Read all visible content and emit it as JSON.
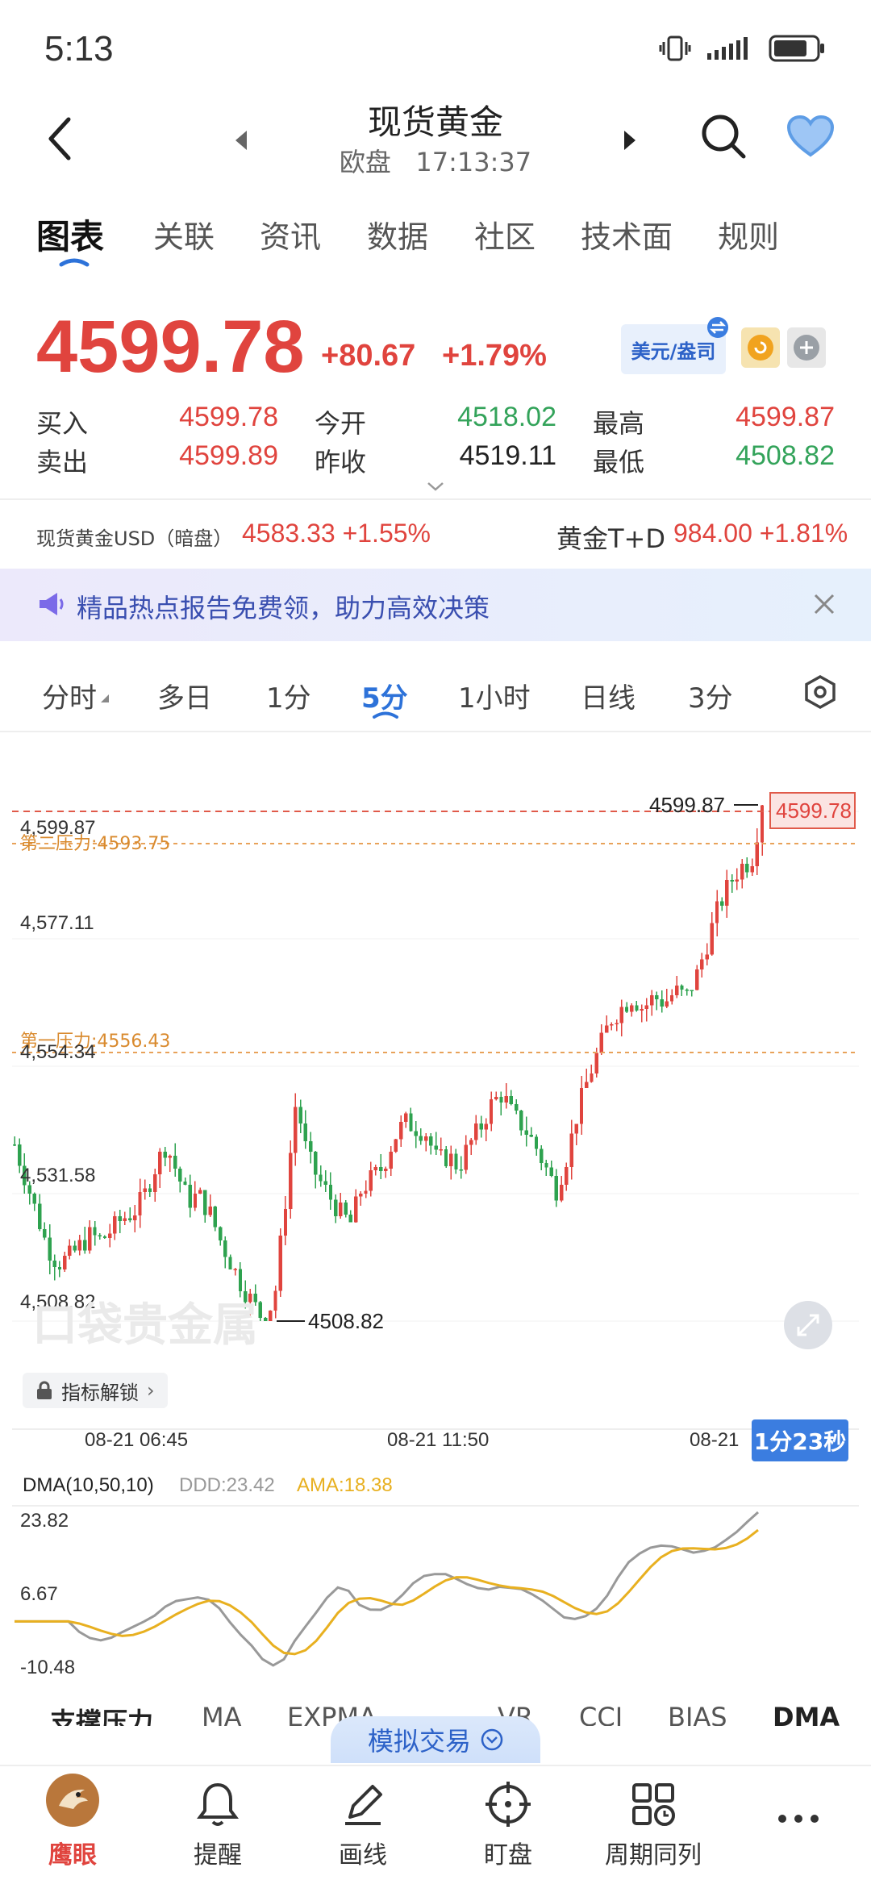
{
  "status": {
    "time": "5:13"
  },
  "header": {
    "title": "现货黄金",
    "session": "欧盘",
    "clock": "17:13:37"
  },
  "tabs": [
    "图表",
    "关联",
    "资讯",
    "数据",
    "社区",
    "技术面",
    "规则"
  ],
  "quote": {
    "price": "4599.78",
    "change": "+80.67",
    "change_pct": "+1.79%",
    "currency_toggle": "美元/盎司",
    "buy_label": "买入",
    "buy": "4599.78",
    "sell_label": "卖出",
    "sell": "4599.89",
    "open_label": "今开",
    "open": "4518.02",
    "prev_label": "昨收",
    "prev": "4519.11",
    "high_label": "最高",
    "high": "4599.87",
    "low_label": "最低",
    "low": "4508.82"
  },
  "related": {
    "left_name": "现货黄金USD（暗盘）",
    "left_value": "4583.33 +1.55%",
    "right_name": "黄金T+D",
    "right_value": "984.00 +1.81%"
  },
  "banner": {
    "text": "精品热点报告免费领，助力高效决策"
  },
  "periods": [
    "分时",
    "多日",
    "1分",
    "5分",
    "1小时",
    "日线",
    "3分"
  ],
  "chart_labels": {
    "y1": "4,599.87",
    "y2": "4,577.11",
    "y3": "4,554.34",
    "y4": "4,531.58",
    "y5": "4,508.82",
    "resist2": "第二压力:4593.75",
    "resist1": "第一压力:4556.43",
    "high_mark": "4599.87",
    "low_mark": "4508.82",
    "last_tag": "4599.78",
    "watermark": "口袋贵金属",
    "indicator_unlock": "指标解锁",
    "x1": "08-21 06:45",
    "x2": "08-21 11:50",
    "x3": "08-21",
    "countdown": "1分23秒"
  },
  "dma": {
    "title": "DMA(10,50,10)",
    "ddd": "DDD:23.42",
    "ama": "AMA:18.38",
    "y_top": "23.82",
    "y_mid": "6.67",
    "y_bot": "-10.48",
    "colors": {
      "ddd": "#999999",
      "ama": "#e8b020"
    }
  },
  "indicator_tabs": [
    "支撑压力",
    "MA",
    "EXPMA",
    "VR",
    "CCI",
    "BIAS",
    "DMA"
  ],
  "sim_trade": "模拟交易",
  "bottom_nav": [
    "鹰眼",
    "提醒",
    "画线",
    "盯盘",
    "周期同列"
  ],
  "chart_data": {
    "type": "candlestick",
    "y_range": [
      4508.82,
      4599.87
    ],
    "close_series": [
      4540,
      4534,
      4528,
      4522,
      4519,
      4520,
      4522,
      4524,
      4523,
      4525,
      4527,
      4528,
      4531,
      4536,
      4540,
      4535,
      4530,
      4531,
      4528,
      4523,
      4519,
      4515,
      4512,
      4509,
      4513,
      4530,
      4548,
      4538,
      4534,
      4531,
      4528,
      4526,
      4532,
      4534,
      4536,
      4541,
      4544,
      4543,
      4542,
      4537,
      4538,
      4536,
      4540,
      4543,
      4547,
      4549,
      4545,
      4543,
      4540,
      4536,
      4532,
      4538,
      4546,
      4552,
      4557,
      4562,
      4564,
      4566,
      4564,
      4566,
      4565,
      4567,
      4566,
      4570,
      4576,
      4582,
      4586,
      4589,
      4590,
      4599.78
    ]
  }
}
